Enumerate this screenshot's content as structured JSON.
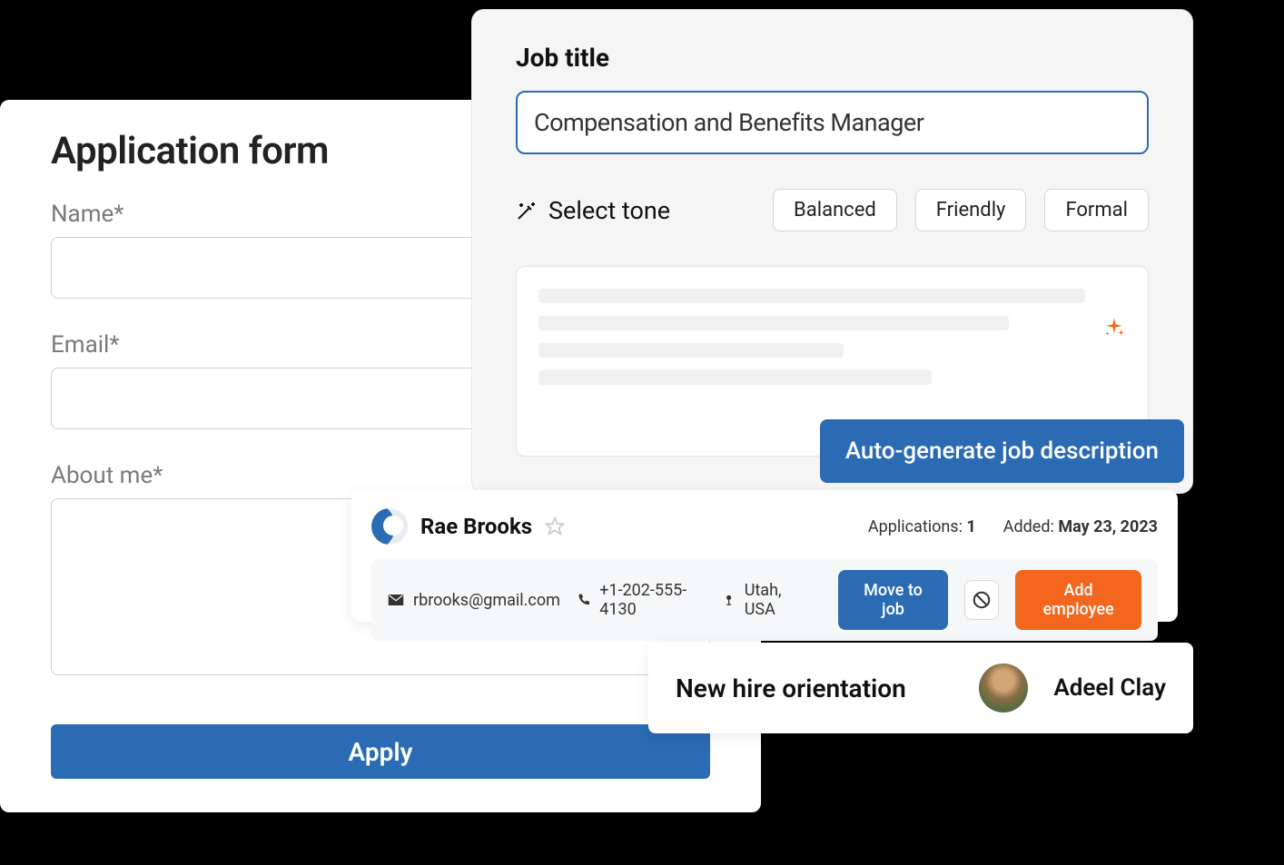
{
  "applicationForm": {
    "title": "Application form",
    "nameLabel": "Name*",
    "emailLabel": "Email*",
    "aboutLabel": "About me*",
    "applyLabel": "Apply"
  },
  "jobDescription": {
    "titleLabel": "Job title",
    "jobTitleValue": "Compensation and Benefits Manager",
    "selectToneLabel": "Select tone",
    "tones": {
      "balanced": "Balanced",
      "friendly": "Friendly",
      "formal": "Formal"
    },
    "autoGenerateLabel": "Auto-generate job description"
  },
  "candidate": {
    "name": "Rae Brooks",
    "applicationsLabel": "Applications: ",
    "applicationsCount": "1",
    "addedLabel": "Added: ",
    "addedDate": "May 23, 2023",
    "email": "rbrooks@gmail.com",
    "phone": "+1-202-555-4130",
    "location": "Utah, USA",
    "moveLabel": "Move to job",
    "addEmployeeLabel": "Add employee"
  },
  "orientation": {
    "title": "New hire orientation",
    "personName": "Adeel Clay"
  }
}
